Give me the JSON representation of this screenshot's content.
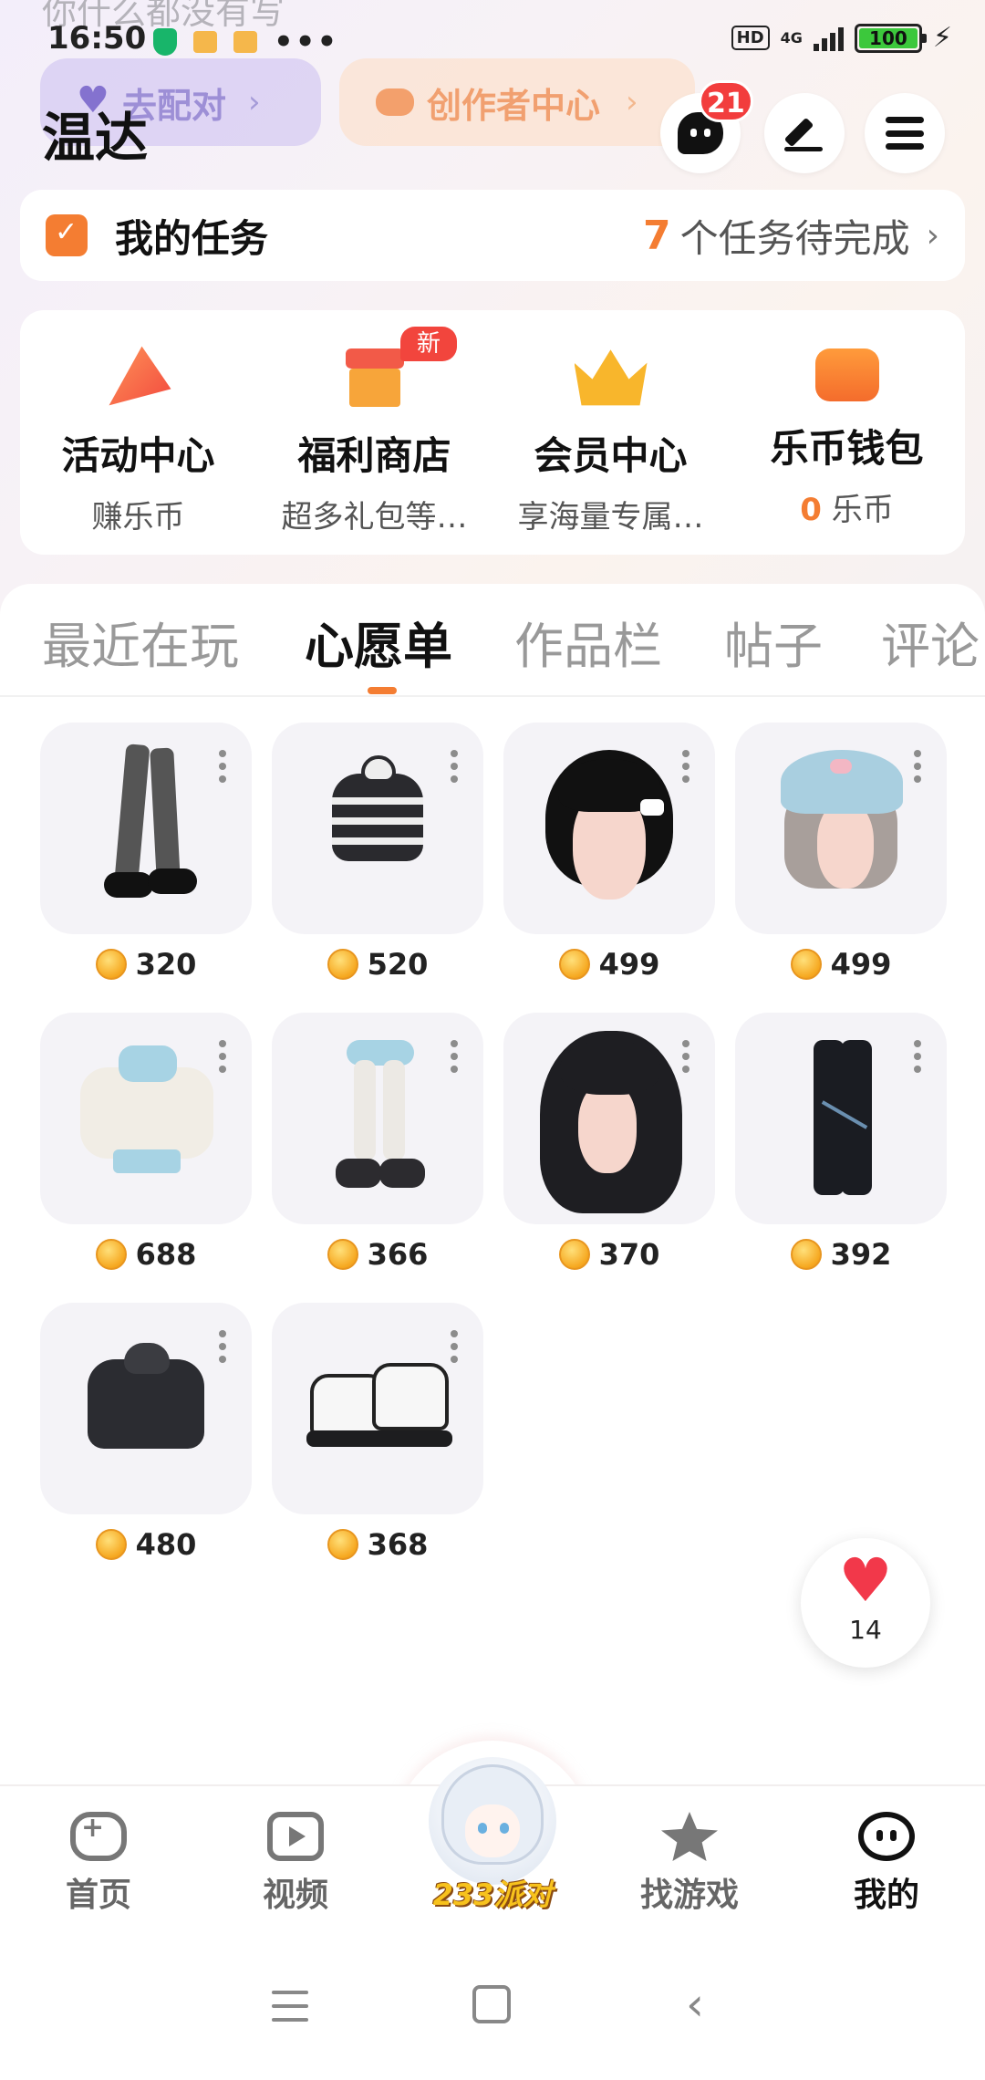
{
  "status_bar": {
    "ghost_text": "你什么都没有写",
    "time": "16:50",
    "more": "•••",
    "hd": "HD",
    "network": "4G",
    "battery": "100"
  },
  "header": {
    "match_label": "去配对",
    "creator_label": "创作者中心",
    "username": "温达",
    "message_badge": "21"
  },
  "tasks": {
    "title": "我的任务",
    "count": "7",
    "text": "个任务待完成"
  },
  "features": [
    {
      "title": "活动中心",
      "subtitle": "赚乐币",
      "icon": "party-popper-icon"
    },
    {
      "title": "福利商店",
      "subtitle": "超多礼包等…",
      "icon": "shop-icon",
      "badge": "新"
    },
    {
      "title": "会员中心",
      "subtitle": "享海量专属…",
      "icon": "crown-icon"
    },
    {
      "title": "乐币钱包",
      "subtitle_value": "0",
      "subtitle_unit": "乐币",
      "icon": "wallet-icon"
    }
  ],
  "tabs": [
    "最近在玩",
    "心愿单",
    "作品栏",
    "帖子",
    "评论"
  ],
  "active_tab": "心愿单",
  "wishlist": [
    {
      "item": "boots",
      "price": "320"
    },
    {
      "item": "striped-hoodie",
      "price": "520"
    },
    {
      "item": "black-bob-hair",
      "price": "499"
    },
    {
      "item": "cat-hat-hair",
      "price": "499"
    },
    {
      "item": "cream-cardigan",
      "price": "688"
    },
    {
      "item": "stockings-platform",
      "price": "366"
    },
    {
      "item": "long-wavy-hair",
      "price": "370"
    },
    {
      "item": "black-cargo-pants",
      "price": "392"
    },
    {
      "item": "dark-hoodie",
      "price": "480"
    },
    {
      "item": "white-sneakers",
      "price": "368"
    }
  ],
  "favorite": {
    "count": "14"
  },
  "bottom_nav": [
    {
      "label": "首页"
    },
    {
      "label": "视频"
    },
    {
      "label": "233派对"
    },
    {
      "label": "找游戏"
    },
    {
      "label": "我的"
    }
  ],
  "colors": {
    "accent": "#f47d32",
    "badge": "#f23d3d",
    "like": "#f2384a"
  }
}
